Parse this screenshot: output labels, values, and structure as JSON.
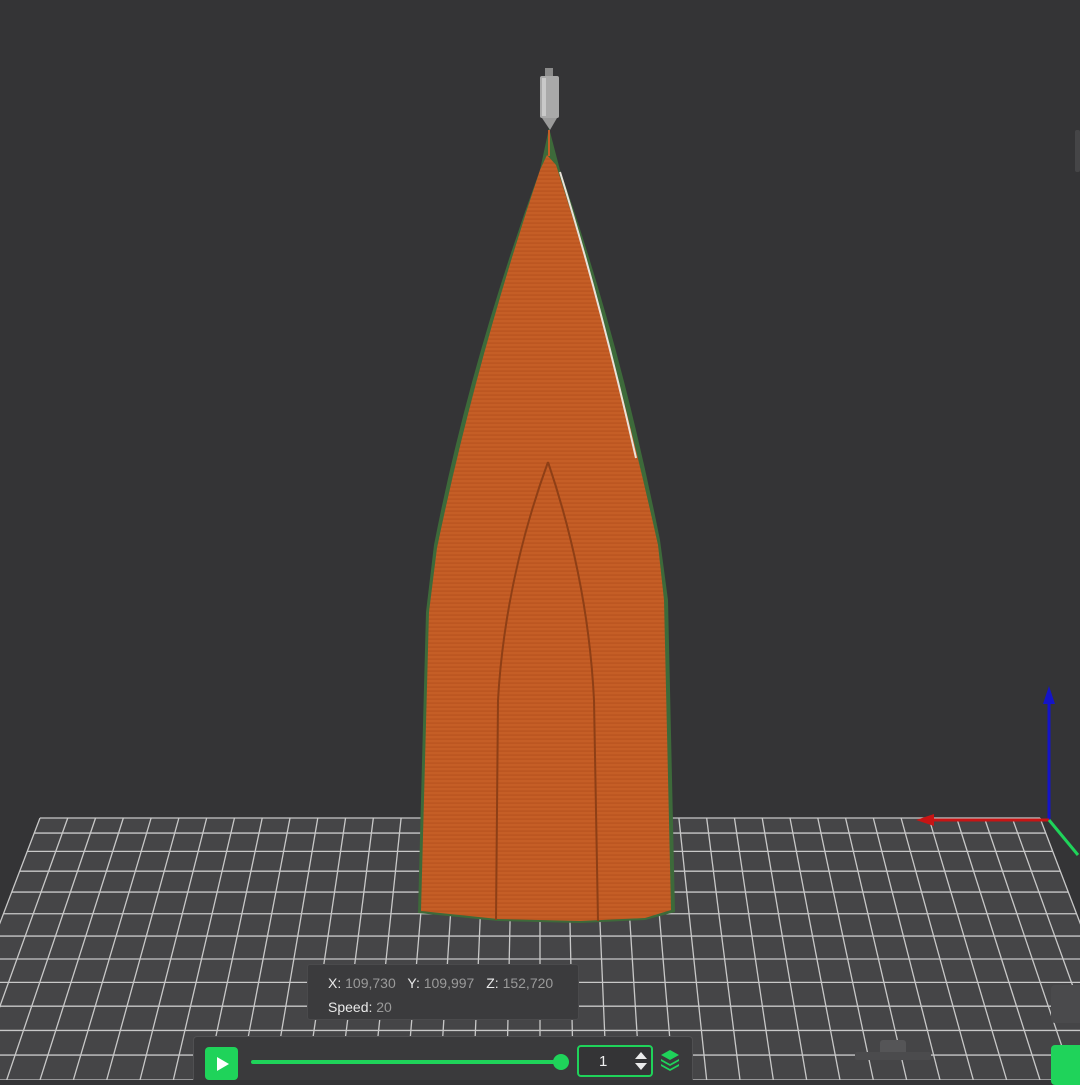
{
  "colors": {
    "background": "#343436",
    "bed_grid": "#c8c8c8",
    "model_fill": "#c55e26",
    "model_outline": "#3d6a3a",
    "accent": "#1fd35a",
    "axis_x": "#c81414",
    "axis_y": "#1fd35a",
    "axis_z": "#1414c8"
  },
  "scene": {
    "nozzle_icon": "print-nozzle-icon",
    "axes_icon": "xyz-axes-gizmo-icon"
  },
  "toolhead": {
    "x_label": "X:",
    "x_value": "109,730",
    "y_label": "Y:",
    "y_value": "109,997",
    "z_label": "Z:",
    "z_value": "152,720",
    "speed_label": "Speed:",
    "speed_value": "20"
  },
  "playback": {
    "play_icon": "play-icon",
    "progress": 1.0,
    "layer_value": "1",
    "spinner_icon": "up-down-spinner-icon",
    "layers_icon": "layers-icon"
  }
}
